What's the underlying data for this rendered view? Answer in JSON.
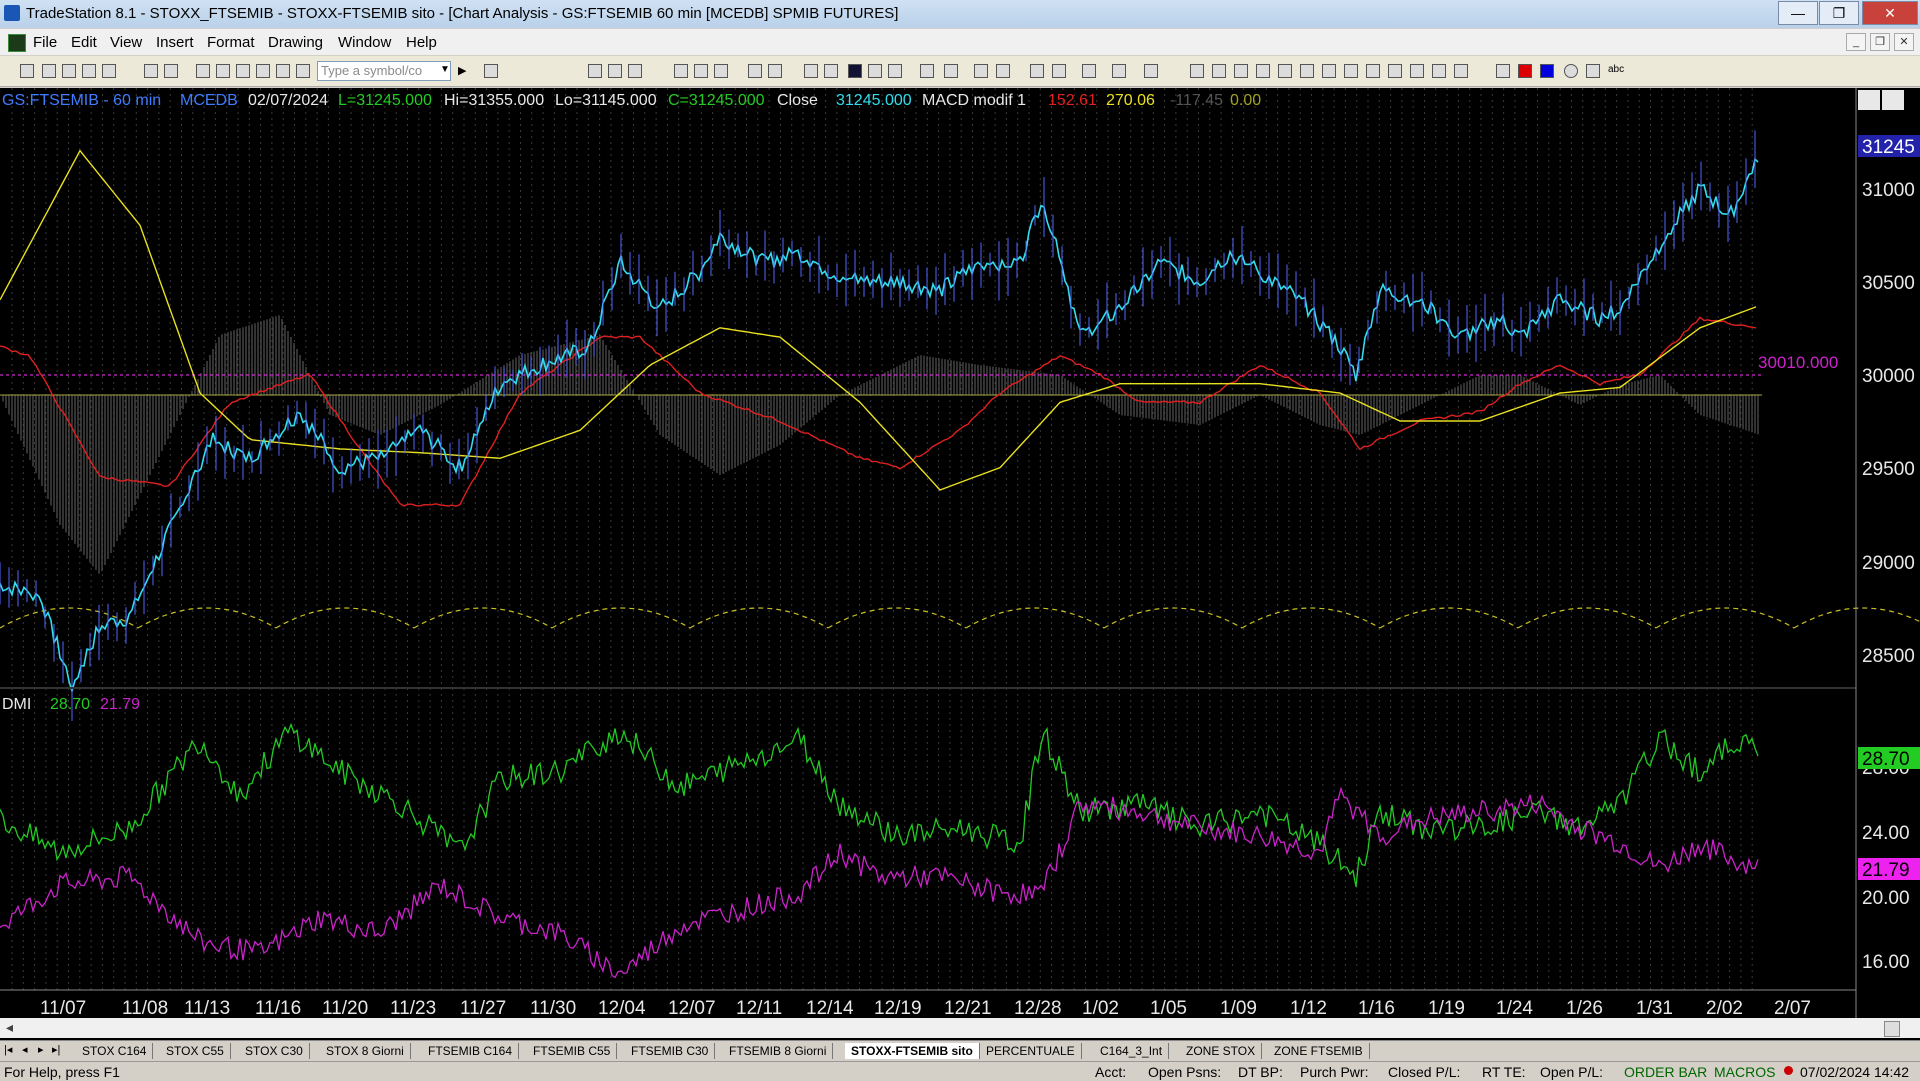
{
  "window": {
    "title": "TradeStation 8.1 - STOXX_FTSEMIB - STOXX-FTSEMIB sito - [Chart Analysis - GS:FTSEMIB  60 min  [MCEDB] SPMIB FUTURES]",
    "minimize": "—",
    "restore": "❐",
    "close": "✕"
  },
  "menu": [
    "File",
    "Edit",
    "View",
    "Insert",
    "Format",
    "Drawing",
    "Window",
    "Help"
  ],
  "symbol_input": {
    "placeholder": "Type a symbol/co"
  },
  "status_line": {
    "symbol": "GS:FTSEMIB - 60 min",
    "exchange": "MCEDB",
    "date": "02/07/2024",
    "last": "L=31245.000",
    "high": "Hi=31355.000",
    "low": "Lo=31145.000",
    "close_eq": "C=31245.000",
    "close_label": "Close",
    "close_value": "31245.000",
    "study": "MACD modif 1",
    "macd_1": "152.61",
    "macd_2": "270.06",
    "macd_3": "-117.45",
    "macd_4": "0.00"
  },
  "colors": {
    "price": "#33ddee",
    "red": "#e02020",
    "yellow": "#e8e020",
    "green": "#22cc22",
    "magenta": "#cc22cc",
    "grid": "#2a2a2a"
  },
  "price_axis": {
    "labels": [
      "31000",
      "30500",
      "30000",
      "29500",
      "29000",
      "28500"
    ],
    "current": "31245",
    "level_line": "30010.000"
  },
  "dmi": {
    "label": "DMI",
    "plus": "28.70",
    "minus": "21.79",
    "axis": [
      "28.00",
      "24.00",
      "20.00",
      "16.00"
    ],
    "plus_tag": "28.70",
    "minus_tag": "21.79"
  },
  "time_axis": [
    "11/07",
    "11/08",
    "11/13",
    "11/16",
    "11/20",
    "11/23",
    "11/27",
    "11/30",
    "12/04",
    "12/07",
    "12/11",
    "12/14",
    "12/19",
    "12/21",
    "12/28",
    "1/02",
    "1/05",
    "1/09",
    "1/12",
    "1/16",
    "1/19",
    "1/24",
    "1/26",
    "1/31",
    "2/02",
    "2/07"
  ],
  "tabs": [
    "STOX C164",
    "STOX C55",
    "STOX  C30",
    "STOX  8 Giorni",
    "FTSEMIB C164",
    "FTSEMIB C55",
    "FTSEMIB C30",
    "FTSEMIB  8 Giorni",
    "STOXX-FTSEMIB sito",
    "PERCENTUALE",
    "C164_3_Int",
    "ZONE STOX",
    "ZONE FTSEMIB"
  ],
  "status_bar": {
    "help": "For Help, press F1",
    "acct": "Acct:",
    "open_psns": "Open Psns:",
    "dt_bp": "DT BP:",
    "purch_pwr": "Purch Pwr:",
    "closed_pl": "Closed P/L:",
    "rt_te": "RT TE:",
    "open_pl": "Open P/L:",
    "order_bar": "ORDER BAR",
    "macros": "MACROS",
    "datetime": "07/02/2024 14:42"
  }
}
